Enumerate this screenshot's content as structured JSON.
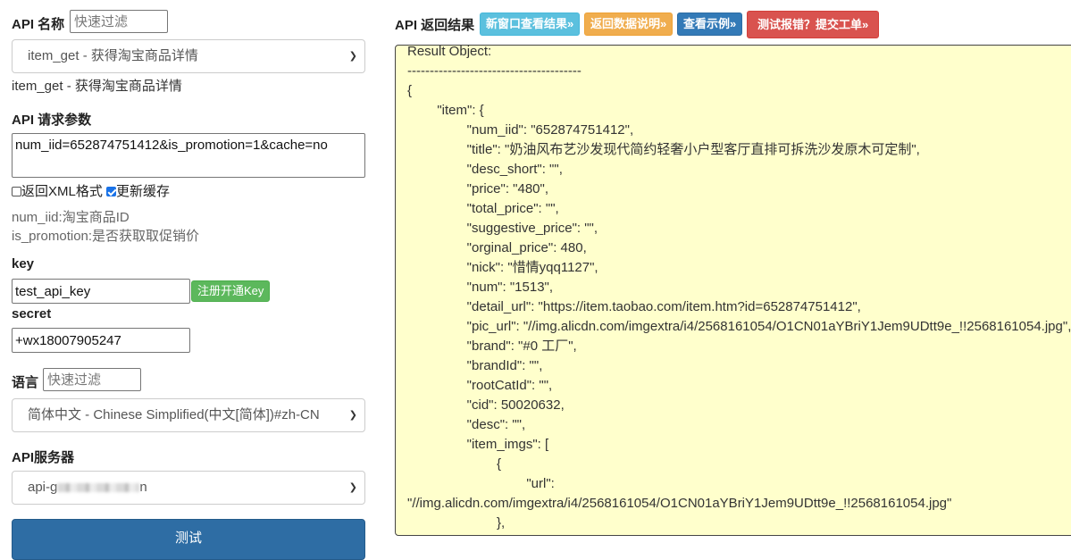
{
  "api_name": {
    "label": "API 名称",
    "filter_placeholder": "快速过滤",
    "selected": "item_get - 获得淘宝商品详情",
    "description": "item_get - 获得淘宝商品详情"
  },
  "params": {
    "label": "API 请求参数",
    "value": "num_iid=652874751412&is_promotion=1&cache=no",
    "xml_checkbox": {
      "label": "返回XML格式",
      "checked": false
    },
    "cache_checkbox": {
      "label": "更新缓存",
      "checked": true
    },
    "help_lines": [
      "num_iid:淘宝商品ID",
      "is_promotion:是否获取取促销价"
    ]
  },
  "key": {
    "label": "key",
    "value": "test_api_key",
    "register_button": "注册开通Key"
  },
  "secret": {
    "label": "secret",
    "value": "+wx18007905247"
  },
  "language": {
    "label": "语言",
    "filter_placeholder": "快速过滤",
    "selected": "简体中文 - Chinese Simplified(中文[简体])#zh-CN"
  },
  "server": {
    "label": "API服务器",
    "selected_prefix": "api-g",
    "selected_suffix": "n"
  },
  "test_button": "测试",
  "result": {
    "label": "API 返回结果",
    "buttons": [
      {
        "label": "新窗口查看结果»",
        "color": "#5bc0de"
      },
      {
        "label": "返回数据说明»",
        "color": "#f0ad4e"
      },
      {
        "label": "查看示例»",
        "color": "#337ab7"
      },
      {
        "label": "测试报错？提交工单»",
        "color": "#d9534f"
      }
    ],
    "lines": [
      "Result Object:",
      "---------------------------------------",
      "{",
      "        \"item\": {",
      "                \"num_iid\": \"652874751412\",",
      "                \"title\": \"奶油风布艺沙发现代简约轻奢小户型客厅直排可拆洗沙发原木可定制\",",
      "                \"desc_short\": \"\",",
      "                \"price\": \"480\",",
      "                \"total_price\": \"\",",
      "                \"suggestive_price\": \"\",",
      "                \"orginal_price\": 480,",
      "                \"nick\": \"惜情yqq1127\",",
      "                \"num\": \"1513\",",
      "                \"detail_url\": \"https://item.taobao.com/item.htm?id=652874751412\",",
      "                \"pic_url\": \"//img.alicdn.com/imgextra/i4/2568161054/O1CN01aYBriY1Jem9UDtt9e_!!2568161054.jpg\",",
      "                \"brand\": \"#0 工厂\",",
      "                \"brandId\": \"\",",
      "                \"rootCatId\": \"\",",
      "                \"cid\": 50020632,",
      "                \"desc\": \"\",",
      "                \"item_imgs\": [",
      "                        {",
      "                                \"url\":",
      "\"//img.alicdn.com/imgextra/i4/2568161054/O1CN01aYBriY1Jem9UDtt9e_!!2568161054.jpg\"",
      "                        },"
    ]
  }
}
